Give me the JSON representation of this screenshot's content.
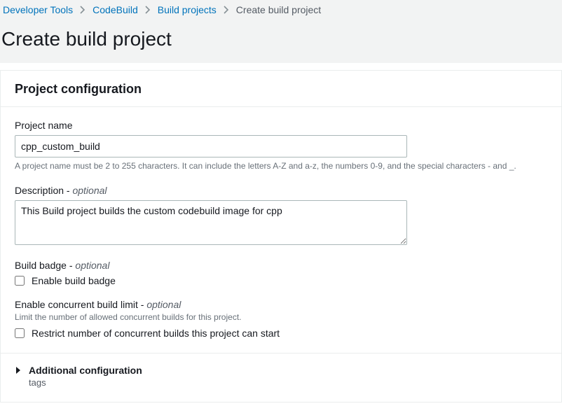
{
  "breadcrumb": {
    "items": [
      {
        "label": "Developer Tools",
        "link": true
      },
      {
        "label": "CodeBuild",
        "link": true
      },
      {
        "label": "Build projects",
        "link": true
      },
      {
        "label": "Create build project",
        "link": false
      }
    ]
  },
  "page": {
    "title": "Create build project"
  },
  "panel": {
    "title": "Project configuration",
    "projectName": {
      "label": "Project name",
      "value": "cpp_custom_build",
      "hint": "A project name must be 2 to 255 characters. It can include the letters A-Z and a-z, the numbers 0-9, and the special characters - and _."
    },
    "description": {
      "labelPrefix": "Description - ",
      "optional": "optional",
      "value": "This Build project builds the custom codebuild image for cpp"
    },
    "buildBadge": {
      "labelPrefix": "Build badge - ",
      "optional": "optional",
      "checkboxLabel": "Enable build badge"
    },
    "concurrent": {
      "labelPrefix": "Enable concurrent build limit - ",
      "optional": "optional",
      "hint": "Limit the number of allowed concurrent builds for this project.",
      "checkboxLabel": "Restrict number of concurrent builds this project can start"
    },
    "additional": {
      "title": "Additional configuration",
      "subtitle": "tags"
    }
  }
}
